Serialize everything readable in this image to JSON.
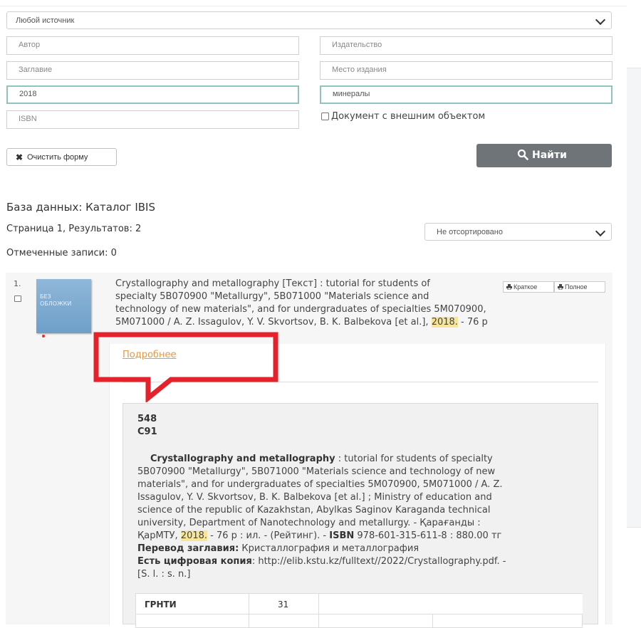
{
  "search": {
    "source_select": "Любой источник",
    "author_placeholder": "Автор",
    "publisher_placeholder": "Издательство",
    "title_placeholder": "Заглавие",
    "place_placeholder": "Место издания",
    "year_value": "2018",
    "keyword_value": "минералы",
    "isbn_placeholder": "ISBN",
    "external_object_label": "Документ с внешним объектом",
    "clear_label": "Очистить форму",
    "find_label": "Найти"
  },
  "results": {
    "database": "База данных: Каталог IBIS",
    "page_info": "Страница 1, Результатов: 2",
    "sort_select": "Не отсортировано",
    "marked": "Отмеченные записи: 0"
  },
  "record": {
    "number": "1.",
    "cover_text": "БЕЗ ОБЛОЖКИ",
    "title_lines": [
      "Crystallography and metallography [Текст] : tutorial for students of",
      "specialty 5B070900 \"Metallurgy\", 5B071000 \"Materials science and",
      "technology of new materials\", and for undergraduates of specialties 5M070900,",
      "5M071000 / A. Z. Issagulov, Y. V. Skvortsov, B. K. Balbekova [et al.], "
    ],
    "title_year": "2018.",
    "title_pages": " - 76 р",
    "brief_label": "Краткое",
    "full_label": "Полное",
    "more_link": "Подробнее",
    "code1": "548",
    "code2": "С91",
    "desc_title": "Crystallography and metallography",
    "desc_line1_rest": " : tutorial for students of specialty",
    "desc_lines": [
      "5B070900 \"Metallurgy\", 5B071000 \"Materials science and technology of new",
      "materials\", and for undergraduates of specialties 5M070900, 5M071000 / A. Z.",
      "Issagulov, Y. V. Skvortsov, B. K. Balbekova [et al.] ; Ministry of education and",
      "science of the republic of Kazakhstan, Abylkas Saginov Karaganda technical",
      "university, Department of Nanotechnology and metallurgy. - Қарағанды :"
    ],
    "desc_pub_pre": "ҚарМТУ, ",
    "desc_year": "2018.",
    "desc_pub_post": " - 76 р : ил. - (Рейтинг). - ",
    "isbn_label": "ISBN",
    "isbn_value": " 978-601-315-611-8 : 880.00 тг",
    "translation_label": "Перевод заглавия:",
    "translation_value": " Кристаллография и металлография",
    "digital_label": "Есть цифровая копия",
    "digital_value": ": http://elib.kstu.kz/fulltext//2022/Crystallography.pdf. -",
    "digital_tail": "[S. l. : s. n.]",
    "table_grnti_label": "ГРНТИ",
    "table_grnti_value": "31"
  },
  "colors": {
    "find_button": "#6f7478",
    "focus_border": "#8fc3bb",
    "link": "#e8973a",
    "highlight": "#f7e59a",
    "callout": "#e5212b"
  }
}
